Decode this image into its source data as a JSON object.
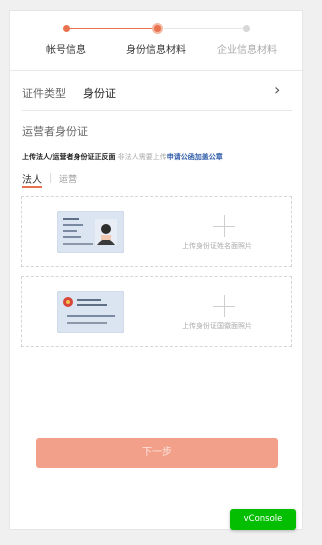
{
  "steps": [
    {
      "label": "帐号信息",
      "state": "done"
    },
    {
      "label": "身份信息材料",
      "state": "active"
    },
    {
      "label": "企业信息材料",
      "state": "pending"
    }
  ],
  "colors": {
    "accent": "#e8734e",
    "pending": "#c8c8c8",
    "button": "#f2a08a",
    "vconsole": "#04be02"
  },
  "id_type": {
    "label": "证件类型",
    "value": "身份证",
    "chevron": "›"
  },
  "section_title": "运营者身份证",
  "instruction": {
    "main": "上传法人/运营者身份证正反面",
    "note": "非法人需要上传",
    "link": "申请公函加盖公章"
  },
  "tabs": [
    {
      "label": "法人",
      "selected": true
    },
    {
      "label": "运营",
      "selected": false
    }
  ],
  "uploads": {
    "front_label": "上传身份证姓名面照片",
    "back_label": "上传身份证国徽面照片"
  },
  "next_button": "下一步",
  "vconsole": "vConsole"
}
